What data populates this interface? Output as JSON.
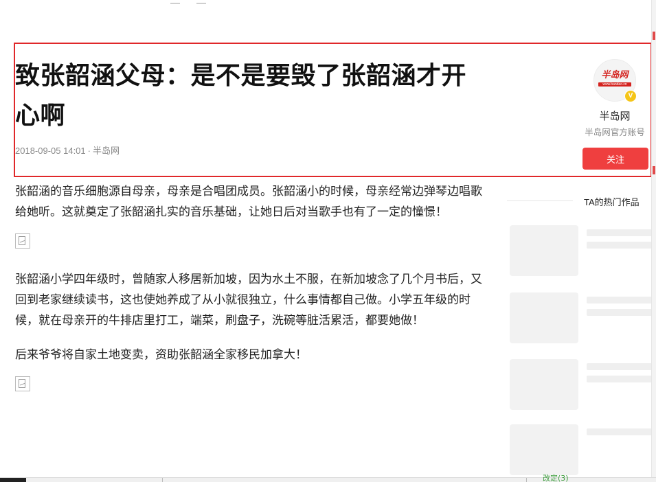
{
  "article": {
    "title": "致张韶涵父母：是不是要毁了张韶涵才开心啊",
    "date": "2018-09-05 14:01",
    "separator": "·",
    "source": "半岛网",
    "paragraphs": [
      "张韶涵的音乐细胞源自母亲，母亲是合唱团成员。张韶涵小的时候，母亲经常边弹琴边唱歌给她听。这就奠定了张韶涵扎实的音乐基础，让她日后对当歌手也有了一定的憧憬！",
      "张韶涵小学四年级时，曾随家人移居新加坡，因为水土不服，在新加坡念了几个月书后，又回到老家继续读书，这也使她养成了从小就很独立，什么事情都自己做。小学五年级的时候，就在母亲开的牛排店里打工，端菜，刷盘子，洗碗等脏活累活，都要她做！",
      "后来爷爷将自家土地变卖，资助张韶涵全家移民加拿大！"
    ]
  },
  "author": {
    "name": "半岛网",
    "description": "半岛网官方账号",
    "follow_label": "关注",
    "avatar_logo_text": "半岛网",
    "avatar_logo_url": "www.bandao.cn",
    "verified_mark": "V"
  },
  "sidebar": {
    "hot_works_title": "TA的热门作品"
  },
  "colors": {
    "accent": "#ef3f3f",
    "highlight_border": "#e0282a",
    "logo_red": "#d4231f",
    "verified_yellow": "#f5c518"
  },
  "taskbar": {
    "fragment_text": "改定(3)"
  }
}
